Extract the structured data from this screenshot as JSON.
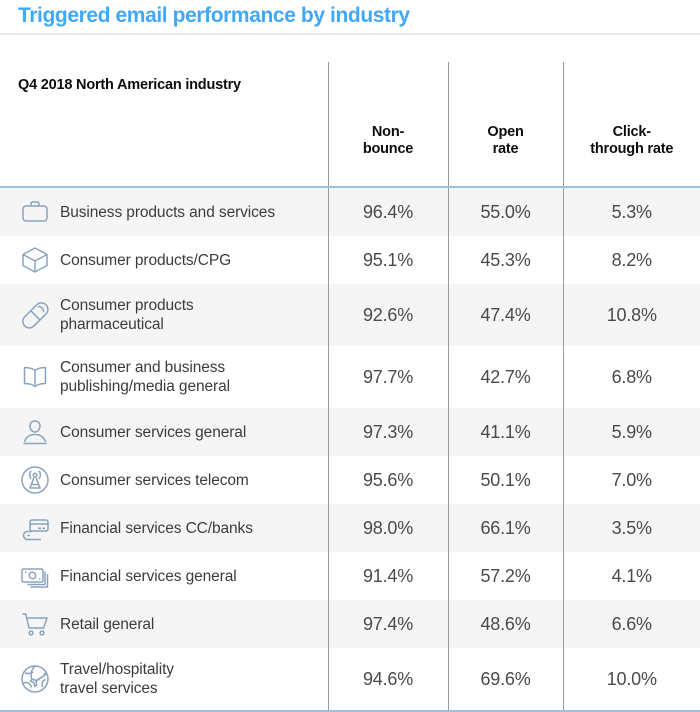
{
  "title": "Triggered email performance by industry",
  "theme": {
    "title_color": "#3fa9f5",
    "rule_color": "#9dbfe0",
    "divider_color": "#9a9a9a",
    "stripe_color": "#f5f5f5",
    "icon_color": "#8aa3bd"
  },
  "columns": {
    "industry": {
      "label": "Q4 2018 North American industry"
    },
    "non_bounce": {
      "line1": "Non-",
      "line2": "bounce"
    },
    "open_rate": {
      "line1": "Open",
      "line2": "rate"
    },
    "click_through_rate": {
      "line1": "Click-",
      "line2": "through rate"
    }
  },
  "chart_data": {
    "type": "table",
    "title": "Triggered email performance by industry",
    "columns": [
      "Q4 2018 North American industry",
      "Non-bounce",
      "Open rate",
      "Click-through rate"
    ],
    "rows": [
      {
        "industry": "Business products and services",
        "icon": "briefcase-icon",
        "non_bounce": "96.4%",
        "open_rate": "55.0%",
        "ctr": "5.3%"
      },
      {
        "industry": "Consumer products/CPG",
        "icon": "box-icon",
        "non_bounce": "95.1%",
        "open_rate": "45.3%",
        "ctr": "8.2%"
      },
      {
        "industry": "Consumer products\npharmaceutical",
        "icon": "pill-capsule-icon",
        "non_bounce": "92.6%",
        "open_rate": "47.4%",
        "ctr": "10.8%"
      },
      {
        "industry": "Consumer and business\npublishing/media general",
        "icon": "open-book-icon",
        "non_bounce": "97.7%",
        "open_rate": "42.7%",
        "ctr": "6.8%"
      },
      {
        "industry": "Consumer services general",
        "icon": "person-icon",
        "non_bounce": "97.3%",
        "open_rate": "41.1%",
        "ctr": "5.9%"
      },
      {
        "industry": "Consumer services telecom",
        "icon": "broadcast-tower-icon",
        "non_bounce": "95.6%",
        "open_rate": "50.1%",
        "ctr": "7.0%"
      },
      {
        "industry": "Financial services CC/banks",
        "icon": "credit-card-hand-icon",
        "non_bounce": "98.0%",
        "open_rate": "66.1%",
        "ctr": "3.5%"
      },
      {
        "industry": "Financial services general",
        "icon": "banknotes-icon",
        "non_bounce": "91.4%",
        "open_rate": "57.2%",
        "ctr": "4.1%"
      },
      {
        "industry": "Retail general",
        "icon": "shopping-cart-icon",
        "non_bounce": "97.4%",
        "open_rate": "48.6%",
        "ctr": "6.6%"
      },
      {
        "industry": "Travel/hospitality\ntravel services",
        "icon": "globe-airplane-icon",
        "non_bounce": "94.6%",
        "open_rate": "69.6%",
        "ctr": "10.0%"
      }
    ],
    "series": [
      {
        "name": "Non-bounce",
        "values": [
          96.4,
          95.1,
          92.6,
          97.7,
          97.3,
          95.6,
          98.0,
          91.4,
          97.4,
          94.6
        ]
      },
      {
        "name": "Open rate",
        "values": [
          55.0,
          45.3,
          47.4,
          42.7,
          41.1,
          50.1,
          66.1,
          57.2,
          48.6,
          69.6
        ]
      },
      {
        "name": "Click-through rate",
        "values": [
          5.3,
          8.2,
          10.8,
          6.8,
          5.9,
          7.0,
          3.5,
          4.1,
          6.6,
          10.0
        ]
      }
    ],
    "categories": [
      "Business products and services",
      "Consumer products/CPG",
      "Consumer products pharmaceutical",
      "Consumer and business publishing/media general",
      "Consumer services general",
      "Consumer services telecom",
      "Financial services CC/banks",
      "Financial services general",
      "Retail general",
      "Travel/hospitality travel services"
    ]
  },
  "rows": [
    {
      "line1": "Business products and services",
      "line2": "",
      "non_bounce": "96.4%",
      "open_rate": "55.0%",
      "ctr": "5.3%"
    },
    {
      "line1": "Consumer products/CPG",
      "line2": "",
      "non_bounce": "95.1%",
      "open_rate": "45.3%",
      "ctr": "8.2%"
    },
    {
      "line1": "Consumer products",
      "line2": "pharmaceutical",
      "non_bounce": "92.6%",
      "open_rate": "47.4%",
      "ctr": "10.8%"
    },
    {
      "line1": "Consumer and business",
      "line2": "publishing/media general",
      "non_bounce": "97.7%",
      "open_rate": "42.7%",
      "ctr": "6.8%"
    },
    {
      "line1": "Consumer services general",
      "line2": "",
      "non_bounce": "97.3%",
      "open_rate": "41.1%",
      "ctr": "5.9%"
    },
    {
      "line1": "Consumer services telecom",
      "line2": "",
      "non_bounce": "95.6%",
      "open_rate": "50.1%",
      "ctr": "7.0%"
    },
    {
      "line1": "Financial services CC/banks",
      "line2": "",
      "non_bounce": "98.0%",
      "open_rate": "66.1%",
      "ctr": "3.5%"
    },
    {
      "line1": "Financial services general",
      "line2": "",
      "non_bounce": "91.4%",
      "open_rate": "57.2%",
      "ctr": "4.1%"
    },
    {
      "line1": "Retail general",
      "line2": "",
      "non_bounce": "97.4%",
      "open_rate": "48.6%",
      "ctr": "6.6%"
    },
    {
      "line1": "Travel/hospitality",
      "line2": "travel services",
      "non_bounce": "94.6%",
      "open_rate": "69.6%",
      "ctr": "10.0%"
    }
  ]
}
